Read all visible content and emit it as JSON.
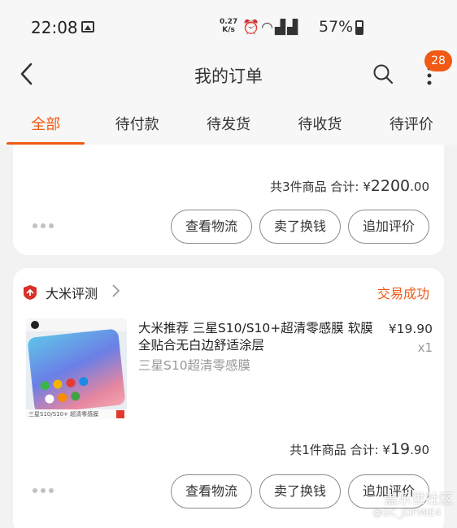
{
  "status_bar": {
    "time": "22:08",
    "net_rate_value": "0.27",
    "net_rate_unit": "K/s",
    "battery": "57%"
  },
  "header": {
    "title": "我的订单",
    "badge_count": "28"
  },
  "tabs": [
    {
      "label": "全部",
      "active": true
    },
    {
      "label": "待付款",
      "active": false
    },
    {
      "label": "待发货",
      "active": false
    },
    {
      "label": "待收货",
      "active": false
    },
    {
      "label": "待评价",
      "active": false
    }
  ],
  "order1": {
    "total_prefix": "共3件商品  合计: ¥",
    "total_int": "2200",
    "total_dec": ".00",
    "buttons": [
      "查看物流",
      "卖了换钱",
      "追加评价"
    ]
  },
  "order2": {
    "shop_name": "大米评测",
    "status": "交易成功",
    "product_title": "大米推荐 三星S10/S10+超清零感膜 软膜全贴合无白边舒适涂层",
    "product_sku": "三星S10超清零感膜",
    "price": "¥19.90",
    "quantity": "x1",
    "thumb_caption": "三星S10/S10+ 超清零感膜",
    "total_prefix": "共1件商品  合计: ¥",
    "total_int": "19",
    "total_dec": ".90",
    "buttons": [
      "查看物流",
      "卖了换钱",
      "追加评价"
    ]
  },
  "watermark": {
    "line1": "盖乐世社区",
    "line2": "@GC_JDFMIE4"
  },
  "colors": {
    "accent": "#f05a14",
    "background": "#f2f2f2"
  }
}
